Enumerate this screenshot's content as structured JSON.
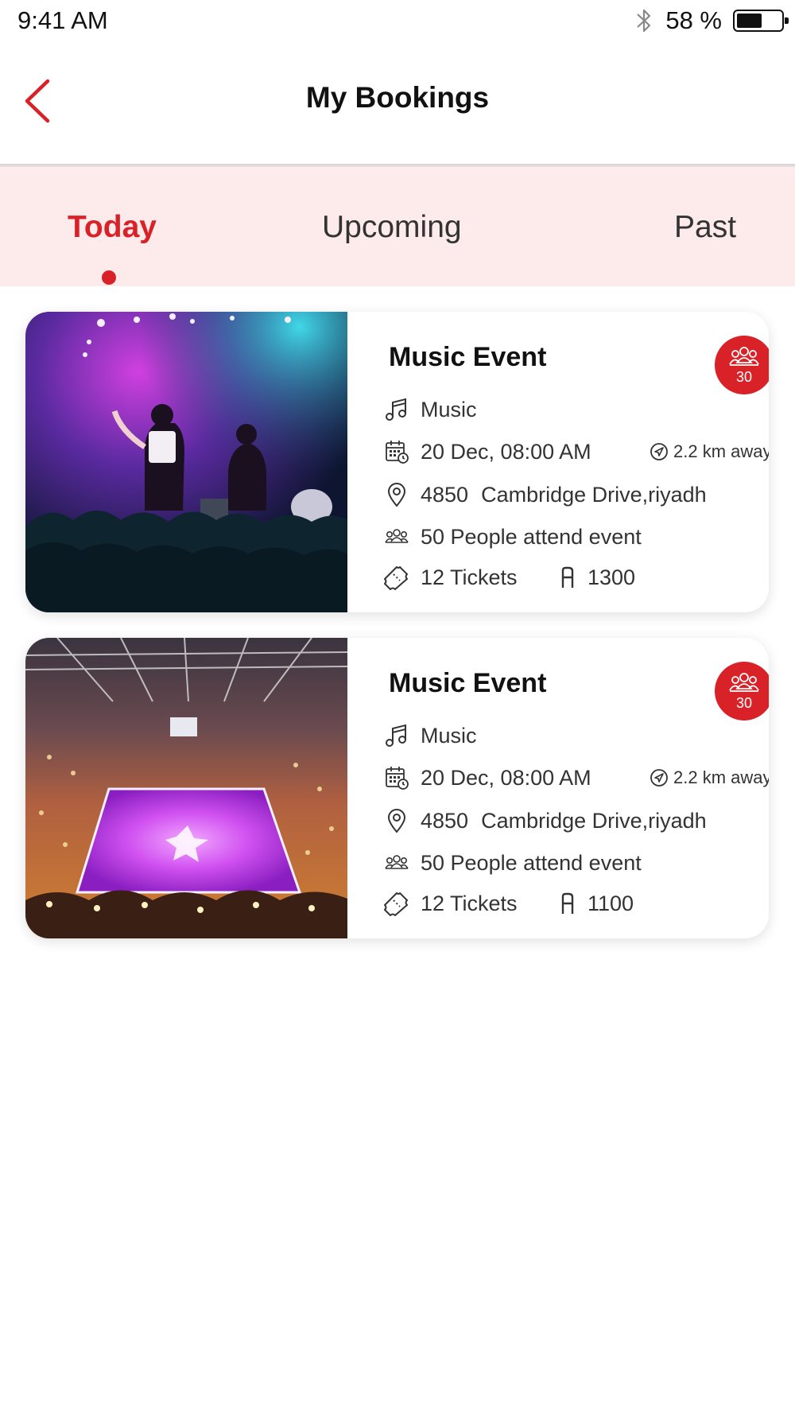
{
  "status_bar": {
    "time": "9:41 AM",
    "battery_percent": "58 %",
    "battery_level": 0.58,
    "icons": [
      "bluetooth-icon",
      "battery-icon"
    ]
  },
  "header": {
    "title": "My Bookings",
    "back_icon": "chevron-left-icon"
  },
  "tabs": [
    {
      "label": "Today",
      "active": true
    },
    {
      "label": "Upcoming",
      "active": false
    },
    {
      "label": "Past",
      "active": false
    }
  ],
  "bookings": [
    {
      "title": "Music Event",
      "badge_count": "30",
      "category": "Music",
      "datetime": "20 Dec, 08:00 AM",
      "distance": "2.2 km away",
      "address_number": "4850",
      "address_street": "Cambridge Drive,riyadh",
      "attendance": "50 People attend event",
      "tickets": "12 Tickets",
      "price": "1300",
      "image": "concert-stage-photo"
    },
    {
      "title": "Music Event",
      "badge_count": "30",
      "category": "Music",
      "datetime": "20 Dec, 08:00 AM",
      "distance": "2.2 km away",
      "address_number": "4850",
      "address_street": "Cambridge Drive,riyadh",
      "attendance": "50 People attend event",
      "tickets": "12 Tickets",
      "price": "1100",
      "image": "arena-photo"
    }
  ],
  "colors": {
    "accent": "#d92128",
    "tab_background": "#fcebea",
    "text": "#333333"
  }
}
